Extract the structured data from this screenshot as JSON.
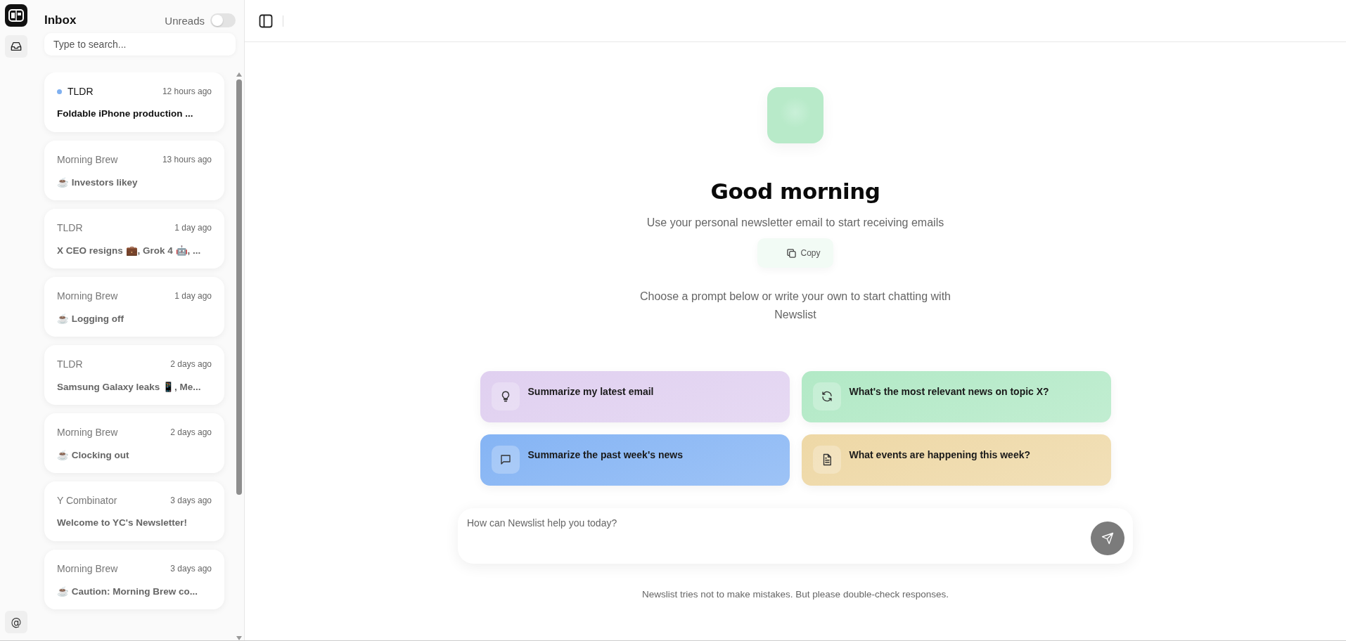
{
  "inbox": {
    "title": "Inbox",
    "unreads_toggle": {
      "label": "Unreads",
      "on": false
    },
    "search": {
      "placeholder": "Type to search..."
    },
    "emails": [
      {
        "sender": "TLDR",
        "time": "12 hours ago",
        "subject": "Foldable iPhone production ...",
        "unread": true
      },
      {
        "sender": "Morning Brew",
        "time": "13 hours ago",
        "subject": "☕ Investors likey",
        "unread": false
      },
      {
        "sender": "TLDR",
        "time": "1 day ago",
        "subject": "X CEO resigns 💼, Grok 4 🤖, ...",
        "unread": false
      },
      {
        "sender": "Morning Brew",
        "time": "1 day ago",
        "subject": "☕ Logging off",
        "unread": false
      },
      {
        "sender": "TLDR",
        "time": "2 days ago",
        "subject": "Samsung Galaxy leaks 📱, Me...",
        "unread": false
      },
      {
        "sender": "Morning Brew",
        "time": "2 days ago",
        "subject": "☕ Clocking out",
        "unread": false
      },
      {
        "sender": "Y Combinator",
        "time": "3 days ago",
        "subject": "Welcome to YC's Newsletter!",
        "unread": false
      },
      {
        "sender": "Morning Brew",
        "time": "3 days ago",
        "subject": "☕ Caution: Morning Brew co...",
        "unread": false
      }
    ]
  },
  "rail": {
    "at_label": "@"
  },
  "main": {
    "greeting": "Good morning",
    "subtitle": "Use your personal newsletter email to start receiving emails",
    "copy_button": "Copy",
    "prompt_hint": "Choose a prompt below or write your own to start chatting with Newslist",
    "prompts": [
      {
        "label": "Summarize my latest email",
        "color": "#e0d0f0"
      },
      {
        "label": "What's the most relevant news on topic X?",
        "color": "#b2e9c6"
      },
      {
        "label": "Summarize the past week's news",
        "color": "#85b4f4"
      },
      {
        "label": "What events are happening this week?",
        "color": "#eed8a6"
      }
    ],
    "chat_input": {
      "placeholder": "How can Newslist help you today?"
    },
    "disclaimer": "Newslist tries not to make mistakes. But please double-check responses."
  }
}
